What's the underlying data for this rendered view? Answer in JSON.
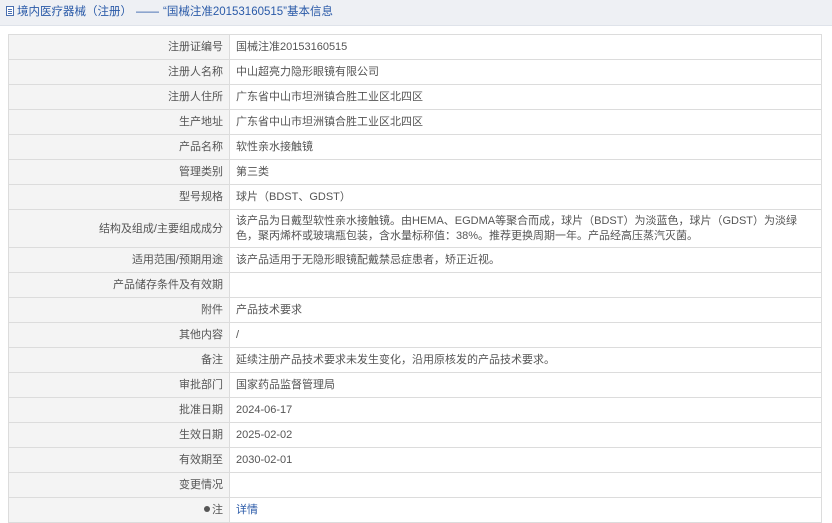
{
  "header": {
    "section": "境内医疗器械（注册）",
    "separator": "——",
    "title": "“国械注准20153160515”基本信息"
  },
  "rows": [
    {
      "label": "注册证编号",
      "value": "国械注准20153160515"
    },
    {
      "label": "注册人名称",
      "value": "中山超亮力隐形眼镜有限公司"
    },
    {
      "label": "注册人住所",
      "value": "广东省中山市坦洲镇合胜工业区北四区"
    },
    {
      "label": "生产地址",
      "value": "广东省中山市坦洲镇合胜工业区北四区"
    },
    {
      "label": "产品名称",
      "value": "软性亲水接触镜"
    },
    {
      "label": "管理类别",
      "value": "第三类"
    },
    {
      "label": "型号规格",
      "value": "球片（BDST、GDST）"
    },
    {
      "label": "结构及组成/主要组成成分",
      "value": "该产品为日戴型软性亲水接触镜。由HEMA、EGDMA等聚合而成，球片（BDST）为淡蓝色，球片（GDST）为淡绿色，聚丙烯杯或玻璃瓶包装，含水量标称值：38%。推荐更换周期一年。产品经高压蒸汽灭菌。"
    },
    {
      "label": "适用范围/预期用途",
      "value": "该产品适用于无隐形眼镜配戴禁忌症患者，矫正近视。"
    },
    {
      "label": "产品储存条件及有效期",
      "value": ""
    },
    {
      "label": "附件",
      "value": "产品技术要求"
    },
    {
      "label": "其他内容",
      "value": "/"
    },
    {
      "label": "备注",
      "value": "延续注册产品技术要求未发生变化，沿用原核发的产品技术要求。"
    },
    {
      "label": "审批部门",
      "value": "国家药品监督管理局"
    },
    {
      "label": "批准日期",
      "value": "2024-06-17"
    },
    {
      "label": "生效日期",
      "value": "2025-02-02"
    },
    {
      "label": "有效期至",
      "value": "2030-02-01"
    },
    {
      "label": "变更情况",
      "value": ""
    },
    {
      "label": "注",
      "value": "详情"
    }
  ]
}
